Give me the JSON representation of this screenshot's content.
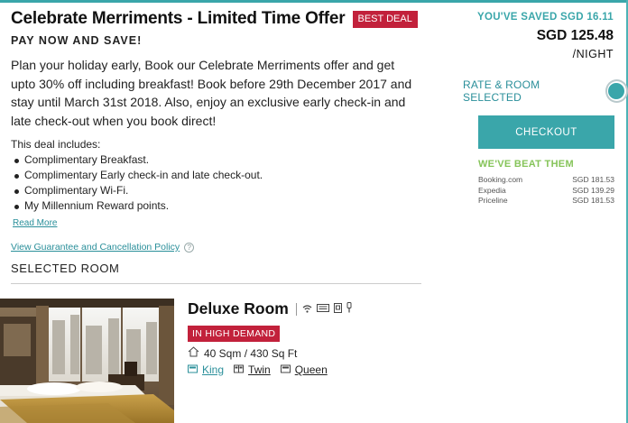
{
  "offer": {
    "title": "Celebrate Merriments - Limited Time Offer",
    "badge": "BEST DEAL",
    "subheading": "PAY NOW AND SAVE!",
    "description": "Plan your holiday early, Book our Celebrate Merriments offer and get upto 30% off including breakfast! Book before 29th December 2017 and stay until March 31st 2018. Also, enjoy an exclusive early check-in and late check-out when you book direct!",
    "includes_label": "This deal includes:",
    "includes": [
      "Complimentary Breakfast.",
      "Complimentary Early check-in and late check-out.",
      "Complimentary Wi-Fi.",
      "My Millennium Reward points."
    ],
    "read_more": "Read More",
    "guarantee_link": "View Guarantee and Cancellation Policy",
    "help_icon_glyph": "?"
  },
  "selected_room": {
    "heading": "SELECTED ROOM",
    "name": "Deluxe Room",
    "demand_badge": "IN HIGH DEMAND",
    "size": "40 Sqm / 430 Sq Ft",
    "beds": [
      "King",
      "Twin",
      "Queen"
    ],
    "selected_bed": "King",
    "amenity_icons": [
      "wifi-icon",
      "tv-icon",
      "safe-icon",
      "hairdryer-icon"
    ],
    "size_icon": "house-icon",
    "bed_icon": "bed-icon"
  },
  "pricing": {
    "saved": "YOU'VE SAVED SGD 16.11",
    "price": "SGD 125.48",
    "per_night": "/NIGHT",
    "rate_selected_label": "RATE & ROOM SELECTED",
    "checkout_label": "CHECKOUT",
    "beat_title": "WE'VE BEAT THEM",
    "competitors": [
      {
        "name": "Booking.com",
        "price": "SGD 181.53"
      },
      {
        "name": "Expedia",
        "price": "SGD 139.29"
      },
      {
        "name": "Priceline",
        "price": "SGD 181.53"
      }
    ]
  },
  "colors": {
    "accent": "#3aa6aa",
    "badge_red": "#c2213b",
    "beat_green": "#86c45a",
    "link": "#2a8f9a"
  }
}
